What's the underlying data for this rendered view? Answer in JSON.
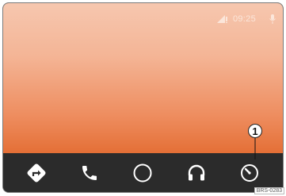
{
  "status": {
    "time": "09:25",
    "signal_icon": "signal-icon",
    "mic_icon": "microphone-icon"
  },
  "dock": {
    "items": [
      {
        "name": "navigation",
        "icon": "navigation-icon"
      },
      {
        "name": "phone",
        "icon": "phone-icon"
      },
      {
        "name": "home",
        "icon": "home-circle-icon"
      },
      {
        "name": "audio",
        "icon": "headphones-icon"
      },
      {
        "name": "vehicle",
        "icon": "speedometer-icon"
      }
    ]
  },
  "callout": {
    "label": "1"
  },
  "reference": {
    "code": "BRS-0283"
  },
  "colors": {
    "screen_top": "#f6c7af",
    "screen_bottom": "#e46f36",
    "dock_bg": "#2b2b2b",
    "icon": "#ffffff"
  }
}
